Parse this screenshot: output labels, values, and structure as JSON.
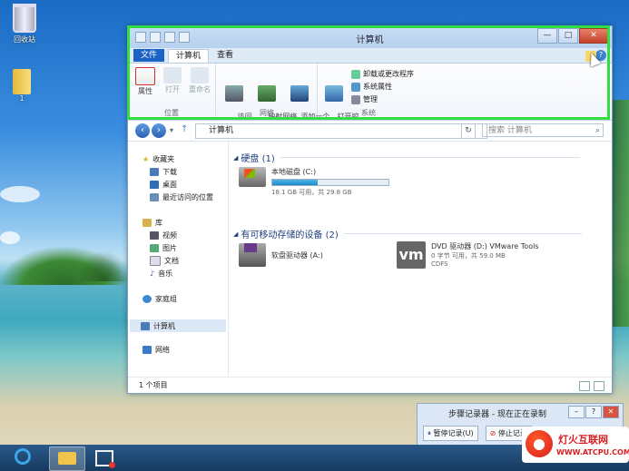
{
  "desktop": {
    "recycle_bin_label": "回收站",
    "folder_label": "1"
  },
  "window": {
    "title": "计算机",
    "tabs": {
      "file": "文件",
      "computer": "计算机",
      "view": "查看"
    },
    "ribbon": {
      "location_group": "位置",
      "network_group": "网络",
      "system_group": "系统",
      "properties": "属性",
      "open": "打开",
      "rename": "重命名",
      "access_media": "访问\n媒体 ▾",
      "map_drive": "映射网络\n驱动器 ▾",
      "add_location": "添加一个\n网络位置",
      "open_control_panel": "打开控\n制面板",
      "uninstall": "卸载或更改程序",
      "system_properties": "系统属性",
      "manage": "管理"
    },
    "address": {
      "path": "计算机",
      "search_placeholder": "搜索 计算机"
    },
    "nav": {
      "favorites": "收藏夹",
      "downloads": "下载",
      "desktop": "桌面",
      "recent": "最近访问的位置",
      "libraries": "库",
      "videos": "视频",
      "pictures": "图片",
      "documents": "文档",
      "music": "音乐",
      "homegroup": "家庭组",
      "computer": "计算机",
      "network": "网络"
    },
    "content": {
      "hard_disks_header": "硬盘 (1)",
      "local_disk_name": "本地磁盘 (C:)",
      "local_disk_free": "18.1 GB 可用，共 29.8 GB",
      "local_disk_used_fraction": 0.39,
      "removable_header": "有可移动存储的设备 (2)",
      "floppy_name": "软盘驱动器 (A:)",
      "dvd_name": "DVD 驱动器 (D:) VMware Tools",
      "dvd_free": "0 字节 可用，共 59.0 MB",
      "dvd_fs": "CDFS",
      "vm_logo": "vm"
    },
    "status": "1 个项目"
  },
  "psr": {
    "title": "步骤记录器 - 现在正在录制",
    "pause": "暂停记录(U)",
    "stop": "停止记录"
  },
  "watermark": {
    "line1": "灯火互联网",
    "line2": "WWW.ATCPU.COM"
  },
  "colors": {
    "highlight": "#33dd44",
    "file_tab": "#1c63c5"
  }
}
